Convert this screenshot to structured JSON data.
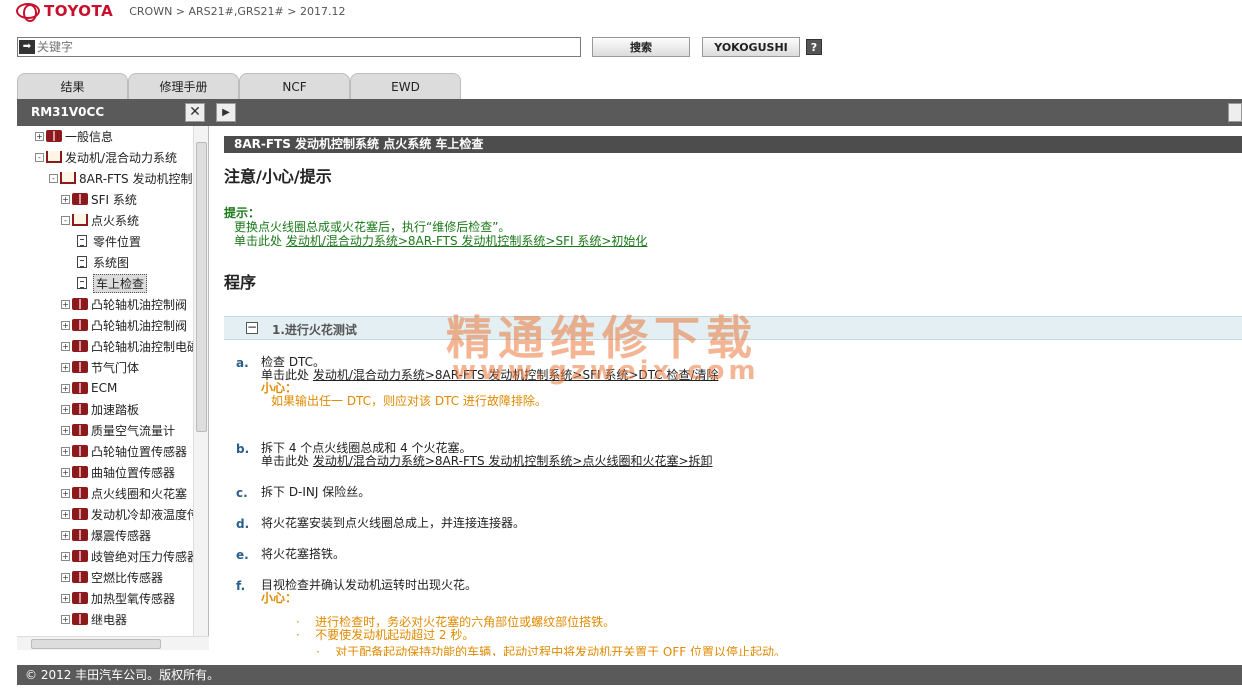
{
  "header": {
    "logo_text": "TOYOTA",
    "breadcrumb": "CROWN > ARS21#,GRS21# > 2017.12"
  },
  "search": {
    "placeholder": "关键字",
    "search_button": "搜索",
    "yoko_button": "YOKOGUSHI",
    "help_label": "?"
  },
  "tabs": [
    "结果",
    "修理手册",
    "NCF",
    "EWD"
  ],
  "docbar": {
    "doc_id": "RM31V0CC",
    "close_label": "✕",
    "next_label": "▶"
  },
  "tree": {
    "items": [
      {
        "label": "一般信息",
        "exp": "+"
      },
      {
        "label": "发动机/混合动力系统",
        "exp": "-"
      },
      {
        "label": "8AR-FTS 发动机控制",
        "exp": "-"
      },
      {
        "label": "SFI 系统",
        "exp": "+"
      },
      {
        "label": "点火系统",
        "exp": "-"
      },
      {
        "label": "零件位置"
      },
      {
        "label": "系统图"
      },
      {
        "label": "车上检查"
      },
      {
        "label": "凸轮轴机油控制阀",
        "exp": "+"
      },
      {
        "label": "凸轮轴机油控制阀",
        "exp": "+"
      },
      {
        "label": "凸轮轴机油控制电磁",
        "exp": "+"
      },
      {
        "label": "节气门体",
        "exp": "+"
      },
      {
        "label": "ECM",
        "exp": "+"
      },
      {
        "label": "加速踏板",
        "exp": "+"
      },
      {
        "label": "质量空气流量计",
        "exp": "+"
      },
      {
        "label": "凸轮轴位置传感器",
        "exp": "+"
      },
      {
        "label": "曲轴位置传感器",
        "exp": "+"
      },
      {
        "label": "点火线圈和火花塞",
        "exp": "+"
      },
      {
        "label": "发动机冷却液温度传",
        "exp": "+"
      },
      {
        "label": "爆震传感器",
        "exp": "+"
      },
      {
        "label": "歧管绝对压力传感器",
        "exp": "+"
      },
      {
        "label": "空燃比传感器",
        "exp": "+"
      },
      {
        "label": "加热型氧传感器",
        "exp": "+"
      },
      {
        "label": "继电器",
        "exp": "+"
      }
    ]
  },
  "content": {
    "title": "8AR-FTS 发动机控制系统  点火系统  车上检查",
    "caution_heading": "注意/小心/提示",
    "hint_label": "提示：",
    "hint_line1": "更换点火线圈总成或火花塞后，执行“维修后检查”。",
    "hint_line2_prefix": "单击此处 ",
    "hint_line2_link": "发动机/混合动力系统>8AR-FTS 发动机控制系统>SFI 系统>初始化",
    "procedure_heading": "程序",
    "step_title": "1.进行火花测试",
    "steps": [
      {
        "letter": "a.",
        "text": "检查 DTC。",
        "sub_prefix": "单击此处 ",
        "sub_link": "发动机/混合动力系统>8AR-FTS 发动机控制系统>SFI 系统>DTC 检查/清除",
        "caution_label": "小心：",
        "caution_text": "如果输出任一 DTC，则应对该 DTC 进行故障排除。"
      },
      {
        "letter": "b.",
        "text": "拆下 4 个点火线圈总成和 4 个火花塞。",
        "sub_prefix": "单击此处 ",
        "sub_link": "发动机/混合动力系统>8AR-FTS 发动机控制系统>点火线圈和火花塞>拆卸"
      },
      {
        "letter": "c.",
        "text": "拆下 D-INJ 保险丝。"
      },
      {
        "letter": "d.",
        "text": "将火花塞安装到点火线圈总成上，并连接连接器。"
      },
      {
        "letter": "e.",
        "text": "将火花塞搭铁。"
      },
      {
        "letter": "f.",
        "text": "目视检查并确认发动机运转时出现火花。",
        "caution_label": "小心：",
        "bullets": [
          "进行检查时，务必对火花塞的六角部位或螺纹部位搭铁。",
          "不要使发动机起动超过 2 秒。",
          "对于配备起动保持功能的车辆，起动过程中将发动机开关置于 OFF 位置以停止起动。"
        ]
      }
    ],
    "watermark_cn": "精通维修下载",
    "watermark_url": "www.gzweix.com"
  },
  "footer": {
    "copyright": "© 2012 丰田汽车公司。版权所有。"
  },
  "colors": {
    "brand_red": "#c8102e",
    "hint_green": "#1a7a1a",
    "caution_orange": "#e08a00",
    "dark_bar": "#5a5a5a"
  }
}
